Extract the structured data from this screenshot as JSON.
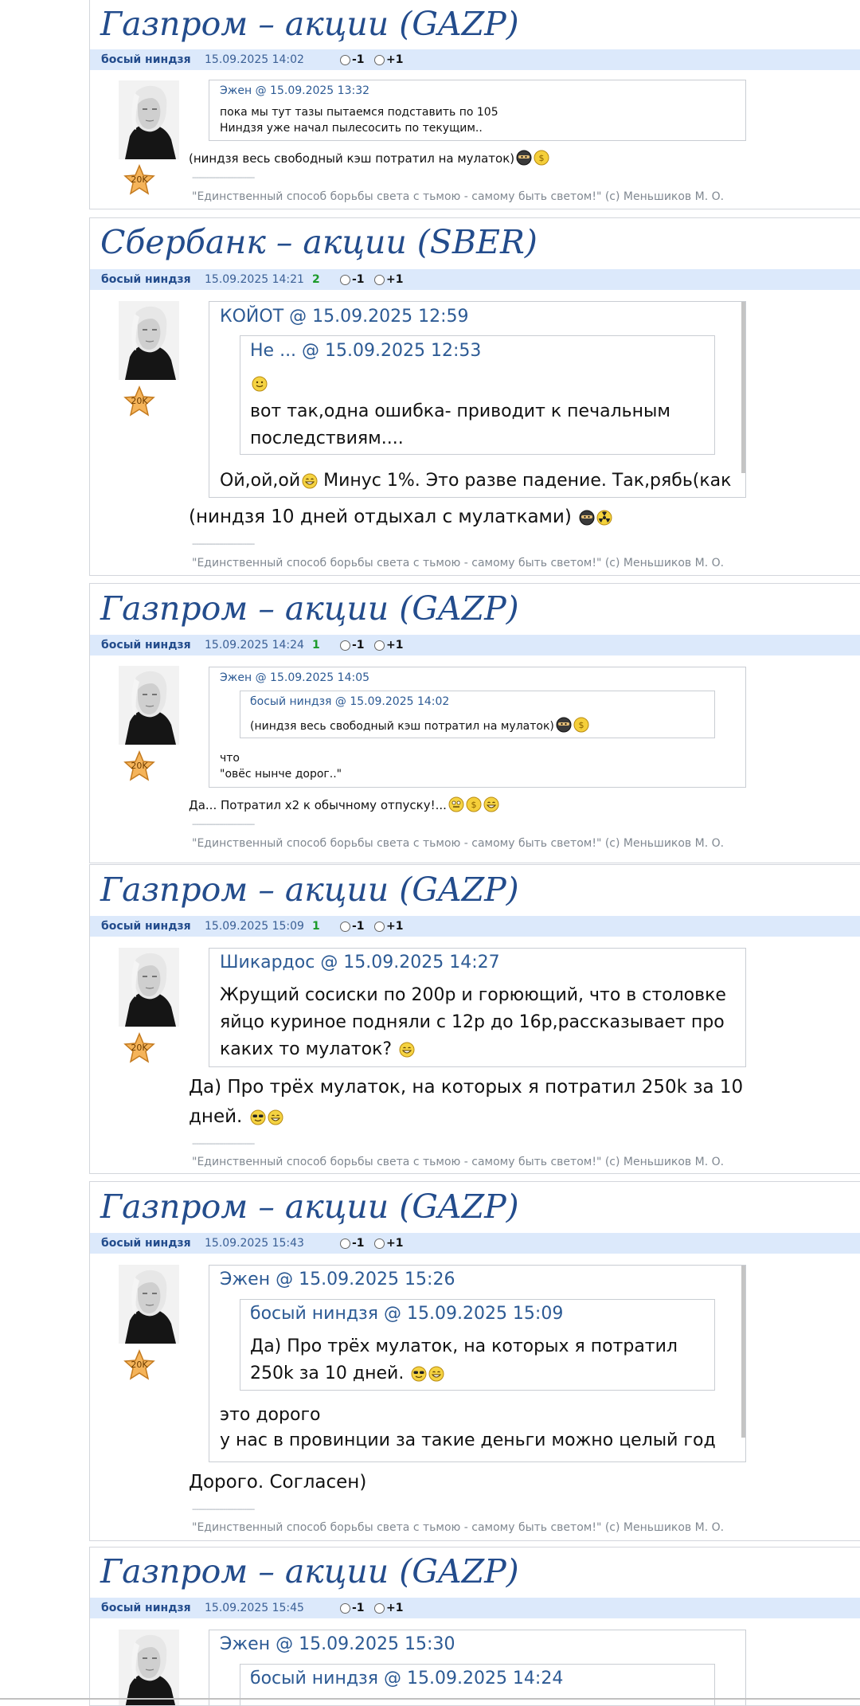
{
  "posts": [
    {
      "title": "Газпром – акции (GAZP)",
      "author": "босый ниндзя",
      "date": "15.09.2025 14:02",
      "rating": "",
      "vote_minus": "-1",
      "vote_plus": "+1",
      "rank_badge": "20K",
      "quote_head": "Эжен @ 15.09.2025 13:32",
      "quote_lines": [
        "пока мы тут тазы пытаемся подставить по 105",
        "Ниндзя уже начал пылесосить по текущим.."
      ],
      "reply": "(ниндзя весь свободный кэш потратил на мулаток)",
      "reply_smileys": [
        "ninja",
        "money"
      ],
      "signature": "\"Единственный способ борьбы света с тьмою - самому быть светом!\" (c) Меньшиков М. О."
    },
    {
      "title": "Сбербанк – акции (SBER)",
      "author": "босый ниндзя",
      "date": "15.09.2025 14:21",
      "rating": "2",
      "vote_minus": "-1",
      "vote_plus": "+1",
      "rank_badge": "20K",
      "quote_head": "КОЙОТ @ 15.09.2025 12:59",
      "inner_quote_head": "Не ... @ 15.09.2025 12:53",
      "inner_quote_smiley": "smile",
      "inner_quote_lines": [
        "вот так,одна ошибка- приводит к печальным",
        "последствиям...."
      ],
      "quote_text_start": "Ой,ой,ой",
      "quote_text_end": " Минус 1%. Это разве падение. Так,рябь(как",
      "reply": "(ниндзя 10 дней отдыхал с мулатками)",
      "reply_smileys": [
        "ninja",
        "radioactive"
      ],
      "signature": "\"Единственный способ борьбы света с тьмою - самому быть светом!\" (c) Меньшиков М. О."
    },
    {
      "title": "Газпром – акции (GAZP)",
      "author": "босый ниндзя",
      "date": "15.09.2025 14:24",
      "rating": "1",
      "vote_minus": "-1",
      "vote_plus": "+1",
      "rank_badge": "20K",
      "quote_head": "Эжен @ 15.09.2025 14:05",
      "inner_quote_head": "босый ниндзя @ 15.09.2025 14:02",
      "inner_quote_text": "(ниндзя весь свободный кэш потратил на мулаток)",
      "quote_lines": [
        "что",
        "\"овёс нынче дорог..\""
      ],
      "reply": "Да... Потратил х2 к обычному отпуску!...",
      "reply_smileys": [
        "grin",
        "money",
        "laugh"
      ],
      "signature": "\"Единственный способ борьбы света с тьмою - самому быть светом!\" (c) Меньшиков М. О."
    },
    {
      "title": "Газпром – акции (GAZP)",
      "author": "босый ниндзя",
      "date": "15.09.2025 15:09",
      "rating": "1",
      "vote_minus": "-1",
      "vote_plus": "+1",
      "rank_badge": "20K",
      "quote_head": "Шикардос @ 15.09.2025 14:27",
      "quote_lines": [
        "Жрущий сосиски по 200р и горюющий, что в столовке",
        "яйцо куриное подняли с 12р до 16р,рассказывает про",
        "каких то мулаток?"
      ],
      "reply_lines": [
        "Да) Про трёх мулаток, на которых я потратил 250k за 10",
        "дней."
      ],
      "reply_smileys": [
        "cool",
        "laugh"
      ],
      "signature": "\"Единственный способ борьбы света с тьмою - самому быть светом!\" (c) Меньшиков М. О."
    },
    {
      "title": "Газпром – акции (GAZP)",
      "author": "босый ниндзя",
      "date": "15.09.2025 15:43",
      "rating": "",
      "vote_minus": "-1",
      "vote_plus": "+1",
      "rank_badge": "20K",
      "quote_head": "Эжен @ 15.09.2025 15:26",
      "inner_quote_head": "босый ниндзя @ 15.09.2025 15:09",
      "inner_quote_lines": [
        "Да) Про трёх мулаток, на которых я потратил",
        "250k за 10 дней."
      ],
      "quote_lines": [
        "это дорого",
        "у нас в провинции за такие деньги можно целый год"
      ],
      "reply": "Дорого. Согласен)",
      "signature": "\"Единственный способ борьбы света с тьмою - самому быть светом!\" (c) Меньшиков М. О."
    },
    {
      "title": "Газпром – акции (GAZP)",
      "author": "босый ниндзя",
      "date": "15.09.2025 15:45",
      "rating": "",
      "vote_minus": "-1",
      "vote_plus": "+1",
      "quote_head": "Эжен @ 15.09.2025 15:30",
      "inner_quote_head": "босый ниндзя @ 15.09.2025 14:24"
    }
  ],
  "colors": {
    "title": "#234c8c",
    "meta_bar": "#dce9fb",
    "author": "#234c8c",
    "rating": "#1c9a2a",
    "quote_head": "#2c5a94",
    "signature": "#808891"
  }
}
